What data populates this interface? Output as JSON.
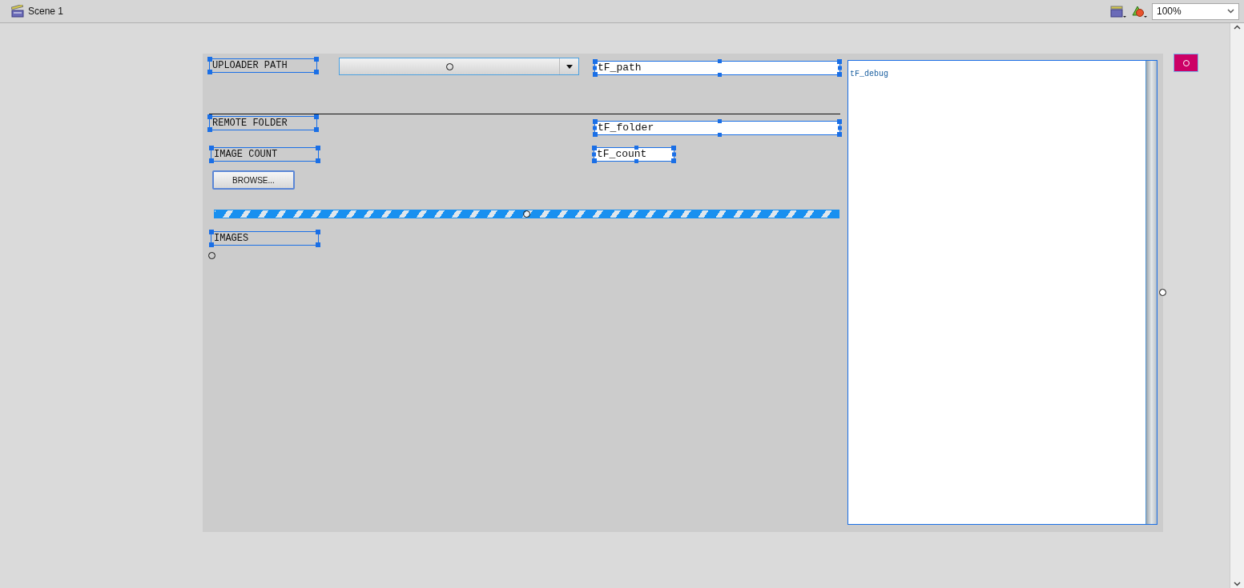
{
  "toolbar": {
    "scene": "Scene 1",
    "zoom": "100%"
  },
  "stage": {
    "labels": [
      "UPLOADER PATH",
      "REMOTE FOLDER",
      "IMAGE COUNT",
      "IMAGES"
    ],
    "fields": [
      "tF_path",
      "tF_folder",
      "tF_count"
    ],
    "browse_button": "BROWSE...",
    "progress_bar": {
      "indeterminate": true
    },
    "debug_field": "tF_debug"
  }
}
